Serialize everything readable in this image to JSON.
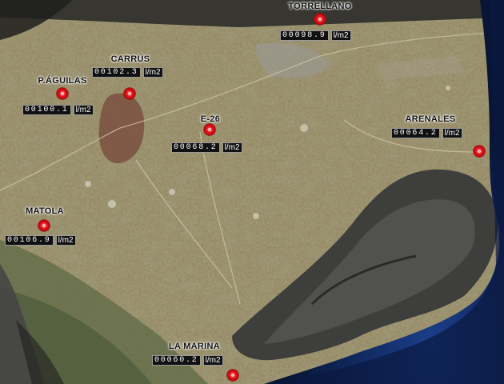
{
  "stations": [
    {
      "id": "torrellano",
      "name": "TORRELLANO",
      "value": "00098.9",
      "unit": "l/m2"
    },
    {
      "id": "carrus",
      "name": "CARRÚS",
      "value": "00102.3",
      "unit": "l/m2"
    },
    {
      "id": "p-aguilas",
      "name": "P.ÁGUILAS",
      "value": "00100.1",
      "unit": "l/m2"
    },
    {
      "id": "e-26",
      "name": "E-26",
      "value": "00068.2",
      "unit": "l/m2"
    },
    {
      "id": "arenales",
      "name": "ARENALES",
      "value": "00064.2",
      "unit": "l/m2"
    },
    {
      "id": "matola",
      "name": "MATOLA",
      "value": "00106.9",
      "unit": "l/m2"
    },
    {
      "id": "la-marina",
      "name": "LA MARINA",
      "value": "00060.2",
      "unit": "l/m2"
    }
  ],
  "colors": {
    "marker": "#e2141b",
    "readout_bg": "#111111",
    "readout_text": "#ffffff",
    "sea": "#0b1f52",
    "land": "#8f8359"
  }
}
